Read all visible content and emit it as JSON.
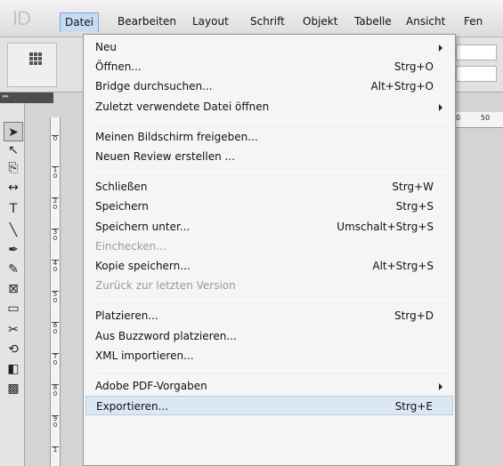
{
  "app": {
    "logo": "ID"
  },
  "menubar": {
    "items": [
      "Datei",
      "Bearbeiten",
      "Layout",
      "Schrift",
      "Objekt",
      "Tabelle",
      "Ansicht",
      "Fen"
    ]
  },
  "toolpanel": {
    "tools": [
      {
        "icon": "selection-tool-icon",
        "glyph": "➤"
      },
      {
        "icon": "direct-selection-tool-icon",
        "glyph": "↖"
      },
      {
        "icon": "page-tool-icon",
        "glyph": "⎘"
      },
      {
        "icon": "gap-tool-icon",
        "glyph": "↔"
      },
      {
        "icon": "type-tool-icon",
        "glyph": "T"
      },
      {
        "icon": "line-tool-icon",
        "glyph": "╲"
      },
      {
        "icon": "pen-tool-icon",
        "glyph": "✒"
      },
      {
        "icon": "pencil-tool-icon",
        "glyph": "✎"
      },
      {
        "icon": "rectangle-frame-tool-icon",
        "glyph": "⊠"
      },
      {
        "icon": "rectangle-tool-icon",
        "glyph": "▭"
      },
      {
        "icon": "scissors-tool-icon",
        "glyph": "✂"
      },
      {
        "icon": "free-transform-tool-icon",
        "glyph": "⟲"
      },
      {
        "icon": "gradient-tool-icon",
        "glyph": "◧"
      },
      {
        "icon": "gradient-feather-tool-icon",
        "glyph": "▩"
      }
    ]
  },
  "vruler": {
    "labels": [
      "0",
      "1\n0",
      "2\n0",
      "3\n0",
      "4\n0",
      "5\n0",
      "6\n0",
      "7\n0",
      "8\n0",
      "9\n0",
      "1"
    ]
  },
  "hruler": {
    "labels": [
      "0",
      "50"
    ]
  },
  "dropdown": {
    "groups": [
      [
        {
          "label": "Neu",
          "shortcut": "",
          "submenu": true,
          "disabled": false
        },
        {
          "label": "Öffnen...",
          "shortcut": "Strg+O",
          "submenu": false,
          "disabled": false
        },
        {
          "label": "Bridge durchsuchen...",
          "shortcut": "Alt+Strg+O",
          "submenu": false,
          "disabled": false
        },
        {
          "label": "Zuletzt verwendete Datei öffnen",
          "shortcut": "",
          "submenu": true,
          "disabled": false
        }
      ],
      [
        {
          "label": "Meinen Bildschirm freigeben...",
          "shortcut": "",
          "submenu": false,
          "disabled": false
        },
        {
          "label": "Neuen Review erstellen ...",
          "shortcut": "",
          "submenu": false,
          "disabled": false
        }
      ],
      [
        {
          "label": "Schließen",
          "shortcut": "Strg+W",
          "submenu": false,
          "disabled": false
        },
        {
          "label": "Speichern",
          "shortcut": "Strg+S",
          "submenu": false,
          "disabled": false
        },
        {
          "label": "Speichern unter...",
          "shortcut": "Umschalt+Strg+S",
          "submenu": false,
          "disabled": false
        },
        {
          "label": "Einchecken...",
          "shortcut": "",
          "submenu": false,
          "disabled": true
        },
        {
          "label": "Kopie speichern...",
          "shortcut": "Alt+Strg+S",
          "submenu": false,
          "disabled": false
        },
        {
          "label": "Zurück zur letzten Version",
          "shortcut": "",
          "submenu": false,
          "disabled": true
        }
      ],
      [
        {
          "label": "Platzieren...",
          "shortcut": "Strg+D",
          "submenu": false,
          "disabled": false
        },
        {
          "label": "Aus Buzzword platzieren...",
          "shortcut": "",
          "submenu": false,
          "disabled": false
        },
        {
          "label": "XML importieren...",
          "shortcut": "",
          "submenu": false,
          "disabled": false
        }
      ],
      [
        {
          "label": "Adobe PDF-Vorgaben",
          "shortcut": "",
          "submenu": true,
          "disabled": false
        },
        {
          "label": "Exportieren...",
          "shortcut": "Strg+E",
          "submenu": false,
          "disabled": false,
          "hovered": true
        }
      ]
    ]
  }
}
